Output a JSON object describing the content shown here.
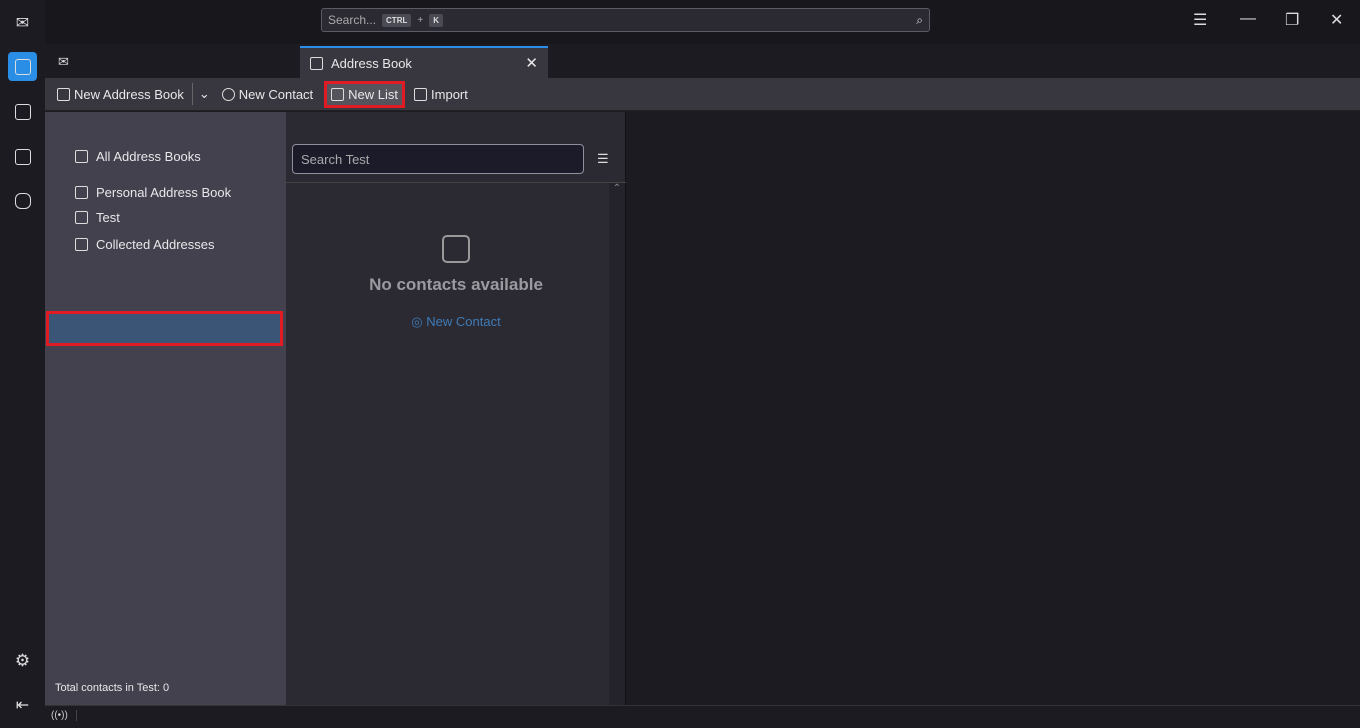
{
  "spaces": {
    "items": [
      "mail",
      "address-book",
      "calendar",
      "tasks",
      "chat"
    ],
    "active": "address-book"
  },
  "titlebar": {
    "search_placeholder": "Search...",
    "shortcut_mod": "CTRL",
    "shortcut_plus": "+",
    "shortcut_key": "K"
  },
  "tab": {
    "label": "Address Book"
  },
  "toolbar": {
    "new_address_book": "New Address Book",
    "new_contact": "New Contact",
    "new_list": "New List",
    "import": "Import"
  },
  "books": {
    "items": [
      {
        "label": "All Address Books"
      },
      {
        "label": "Personal Address Book"
      },
      {
        "label": "Test",
        "selected": true
      },
      {
        "label": "Collected Addresses"
      }
    ],
    "total": "Total contacts in Test: 0"
  },
  "list": {
    "search_placeholder": "Search Test",
    "empty_title": "No contacts available",
    "empty_action": "New Contact"
  },
  "colors": {
    "accent": "#2a8ee6",
    "highlight": "#e01b24",
    "selected": "#3b5576"
  }
}
